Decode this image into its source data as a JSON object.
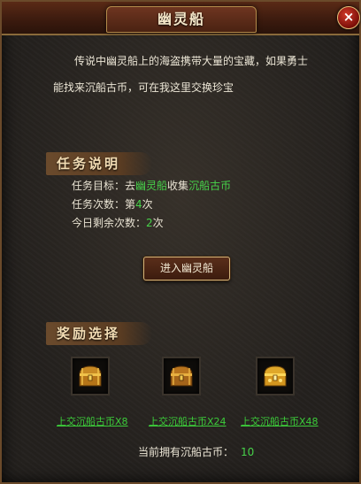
{
  "window": {
    "title": "幽灵船",
    "close_label": "×"
  },
  "intro": {
    "line1": "传说中幽灵船上的海盗携带大量的宝藏，如果勇士",
    "line2": "能找来沉船古币，可在我这里交换珍宝"
  },
  "task": {
    "heading": "任务说明",
    "goal_label": "任务目标：",
    "goal_prefix": "去",
    "goal_place": "幽灵船",
    "goal_verb": "收集",
    "goal_item": "沉船古币",
    "count_label": "任务次数：第",
    "count_value": "4",
    "count_suffix": "次",
    "remaining_label": "今日剩余次数：",
    "remaining_value": "2",
    "remaining_suffix": "次"
  },
  "enter_button": "进入幽灵船",
  "rewards": {
    "heading": "奖励选择",
    "items": [
      {
        "label": "上交沉船古币X8",
        "icon": "treasure-chest-icon"
      },
      {
        "label": "上交沉船古币X24",
        "icon": "treasure-chest-icon"
      },
      {
        "label": "上交沉船古币X48",
        "icon": "treasure-chest-icon"
      }
    ]
  },
  "owned": {
    "label": "当前拥有沉船古币：",
    "value": "10"
  },
  "colors": {
    "highlight_green": "#47d24a",
    "frame_brown": "#6b4a2a",
    "close_red": "#c0281c"
  }
}
